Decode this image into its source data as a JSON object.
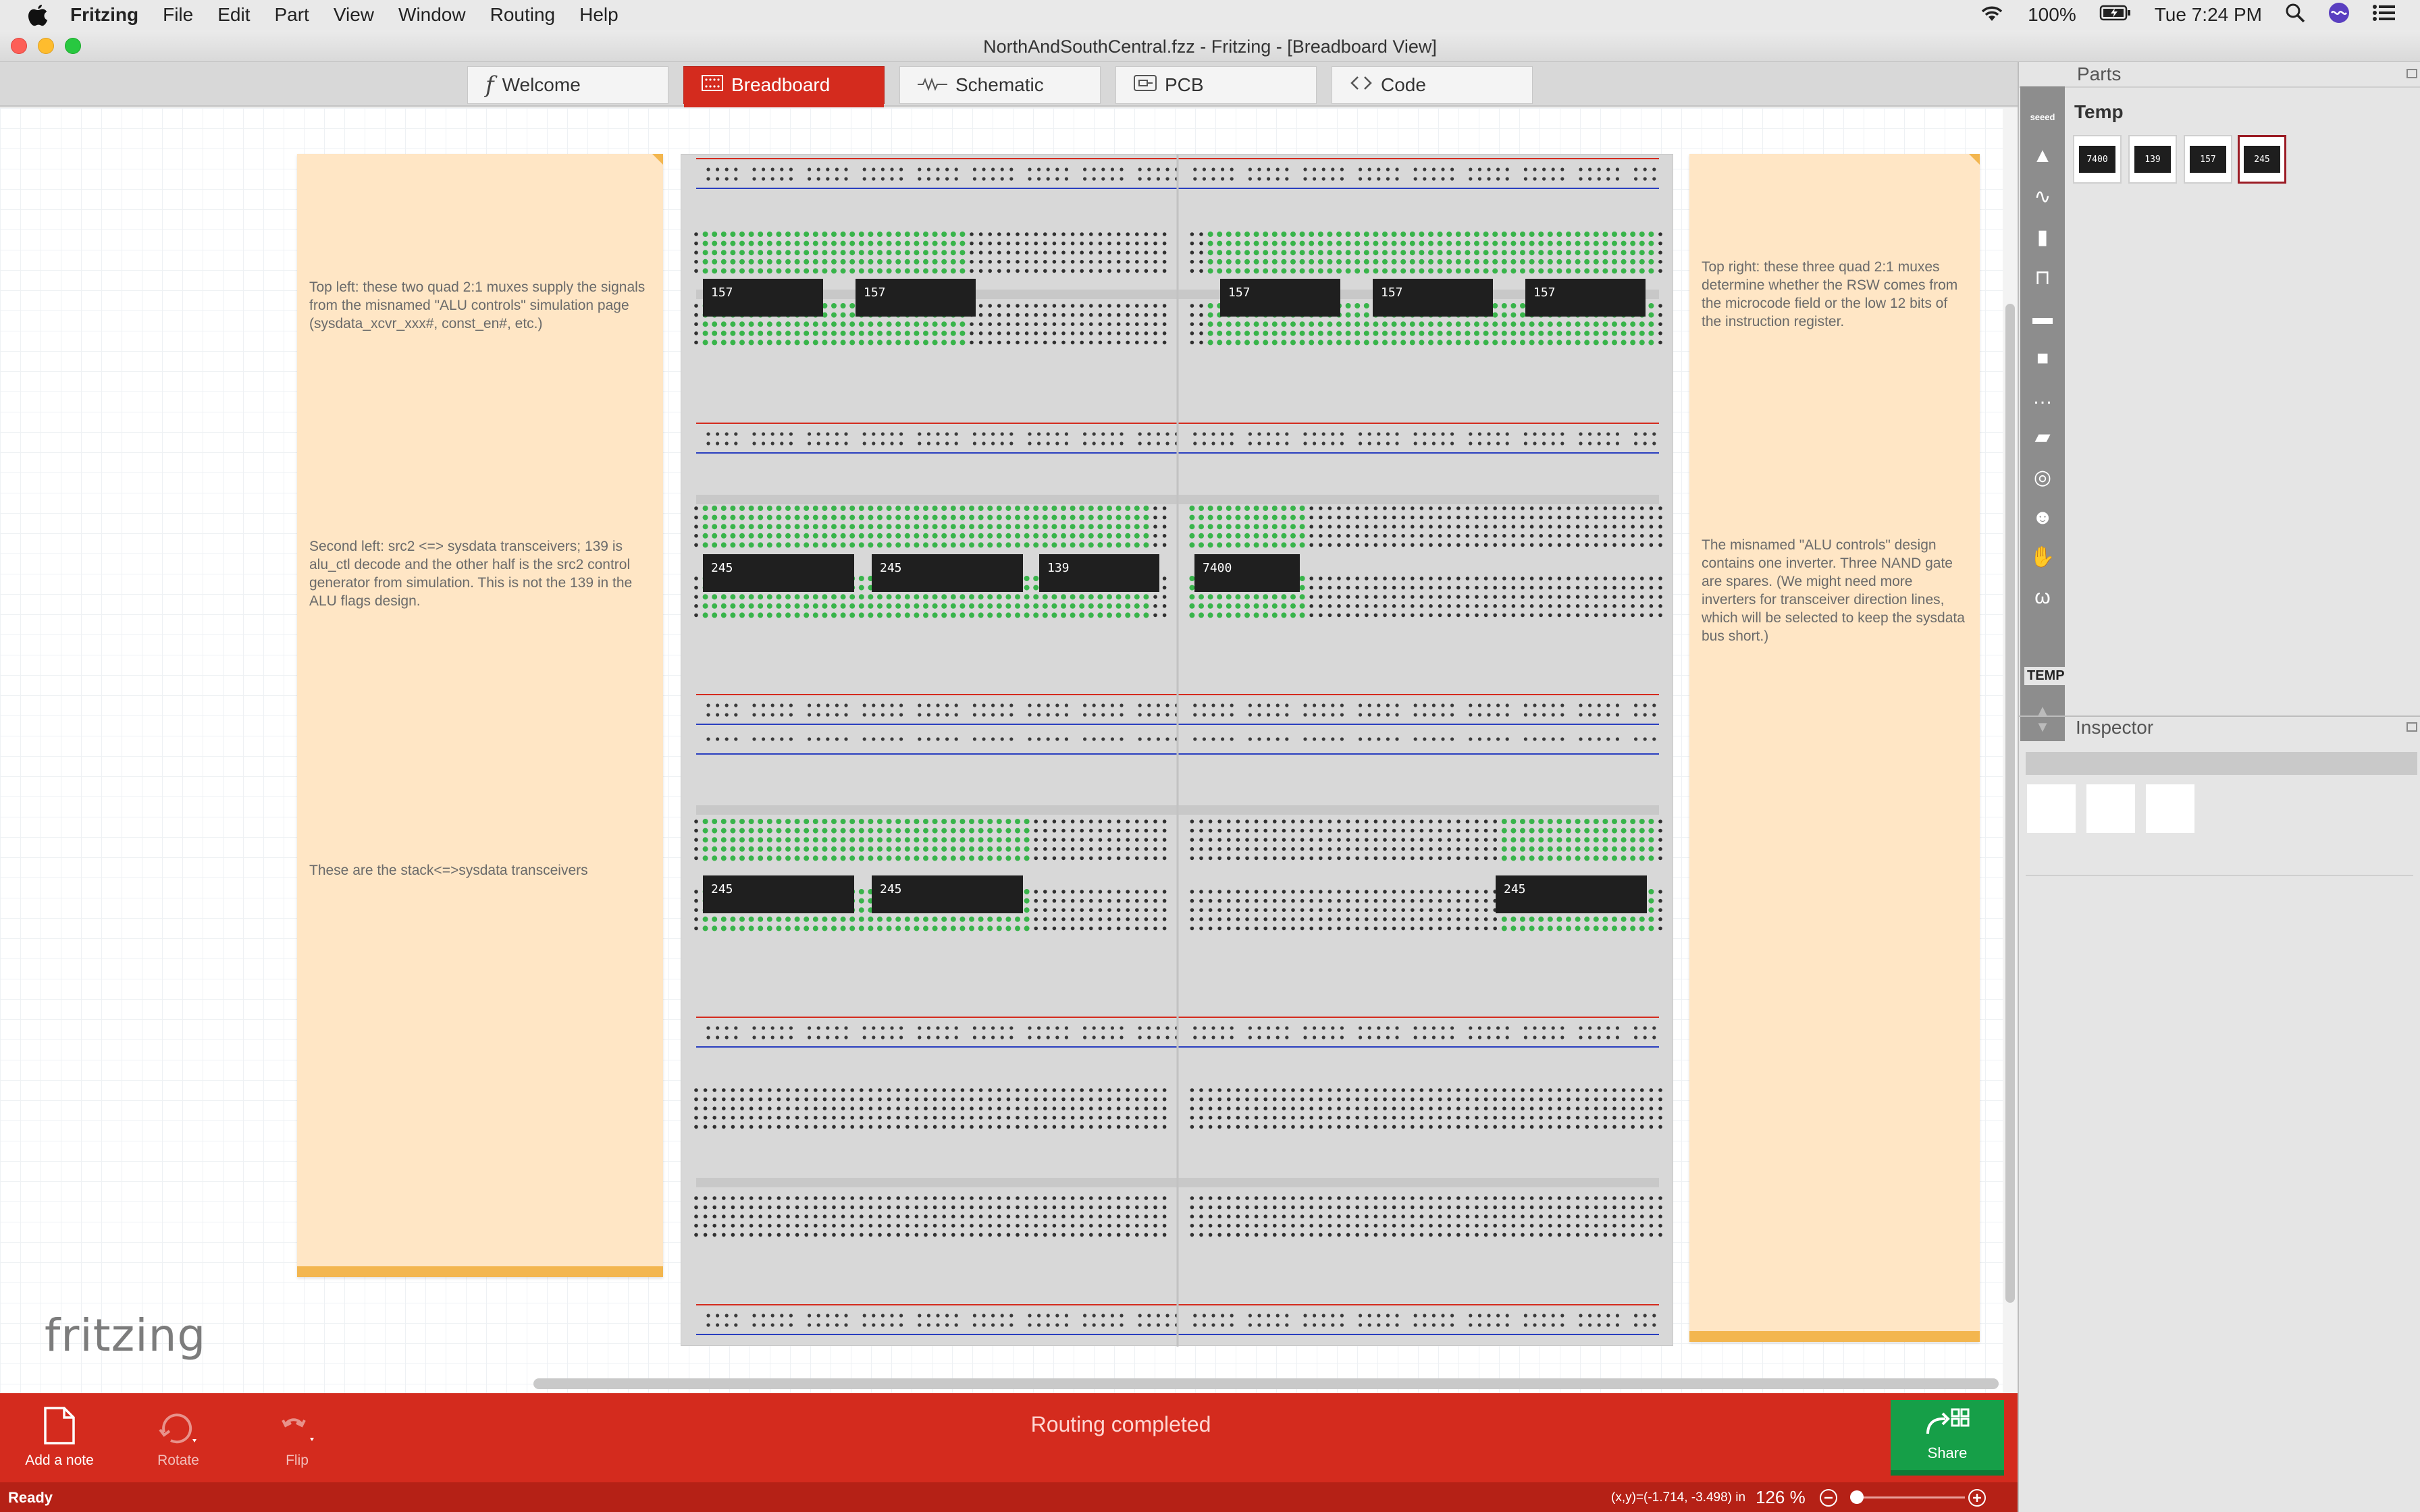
{
  "menubar": {
    "app_name": "Fritzing",
    "menus": [
      "File",
      "Edit",
      "Part",
      "View",
      "Window",
      "Routing",
      "Help"
    ],
    "battery": "100%",
    "clock": "Tue 7:24 PM"
  },
  "window": {
    "title": "NorthAndSouthCentral.fzz - Fritzing - [Breadboard View]"
  },
  "tabs": [
    {
      "label": "Welcome",
      "active": false
    },
    {
      "label": "Breadboard",
      "active": true
    },
    {
      "label": "Schematic",
      "active": false
    },
    {
      "label": "PCB",
      "active": false
    },
    {
      "label": "Code",
      "active": false
    }
  ],
  "notes": {
    "left": [
      "Top left: these two quad 2:1 muxes supply the signals from the misnamed \"ALU controls\" simulation page (sysdata_xcvr_xxx#, const_en#, etc.)",
      "Second left: src2 <=> sysdata transceivers; 139 is alu_ctl decode and the other half is the src2 control generator from simulation. This is not the 139 in the ALU flags design.",
      "These are the stack<=>sysdata transceivers"
    ],
    "right": [
      "Top right: these three quad 2:1 muxes determine whether the RSW comes from the microcode field or the low 12 bits of the instruction register.",
      "The misnamed \"ALU controls\" design contains one inverter. Three NAND gate are spares. (We might need more inverters for transceiver direction lines, which will be selected to keep the sysdata bus short.)"
    ]
  },
  "breadboard": {
    "chips": {
      "row1": [
        "157",
        "157",
        "157",
        "157",
        "157"
      ],
      "row2": [
        "245",
        "245",
        "139",
        "7400"
      ],
      "row3": [
        "245",
        "245",
        "245"
      ]
    }
  },
  "logo": "fritzing",
  "toolbar": {
    "add_note": "Add a note",
    "rotate": "Rotate",
    "flip": "Flip",
    "status": "Routing completed",
    "share": "Share"
  },
  "statusbar": {
    "ready": "Ready",
    "coords": "(x,y)=(-1.714, -3.498) in",
    "zoom": "126",
    "zoom_unit": "%"
  },
  "parts": {
    "header": "Parts",
    "bin_title": "Temp",
    "bin_label": "TEMP",
    "items": [
      "7400",
      "139",
      "157",
      "245"
    ],
    "selected_index": 3
  },
  "inspector": {
    "header": "Inspector"
  },
  "colors": {
    "accent_red": "#d42b1e",
    "share_green": "#169f48",
    "note_fill": "#ffe6c5",
    "note_edge": "#f3b64f"
  }
}
